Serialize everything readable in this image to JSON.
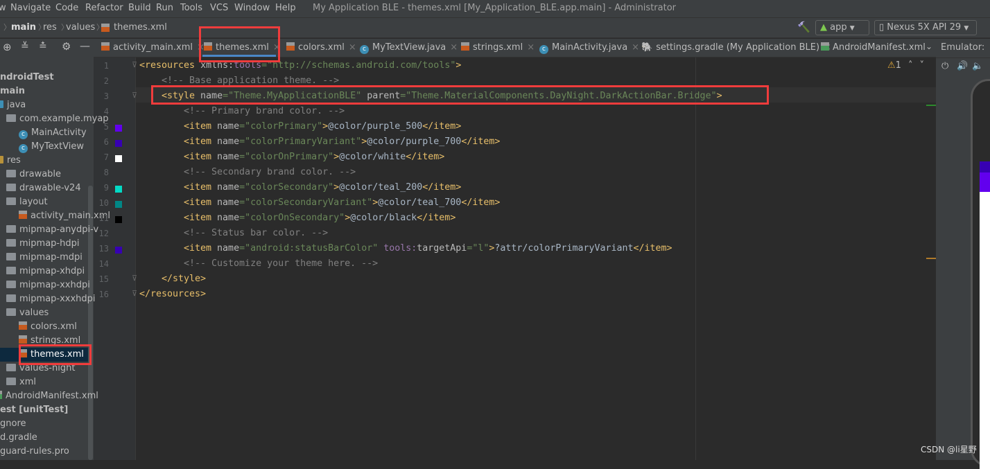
{
  "menu": [
    "w",
    "Navigate",
    "Code",
    "Refactor",
    "Build",
    "Run",
    "Tools",
    "VCS",
    "Window",
    "Help"
  ],
  "window_title": "My Application BLE - themes.xml [My_Application_BLE.app.main] - Administrator",
  "breadcrumb": [
    "main",
    "res",
    "values",
    "themes.xml"
  ],
  "toolbar": {
    "run_config": "app",
    "device": "Nexus 5X API 29"
  },
  "tabs": [
    {
      "label": "activity_main.xml",
      "icon": "xml"
    },
    {
      "label": "themes.xml",
      "icon": "xml",
      "active": true
    },
    {
      "label": "colors.xml",
      "icon": "xml"
    },
    {
      "label": "MyTextView.java",
      "icon": "class"
    },
    {
      "label": "strings.xml",
      "icon": "xml"
    },
    {
      "label": "MainActivity.java",
      "icon": "class"
    },
    {
      "label": "settings.gradle (My Application BLE)",
      "icon": "gradle"
    },
    {
      "label": "AndroidManifest.xml",
      "icon": "manifest"
    }
  ],
  "emulator_label": "Emulator:",
  "inspection": {
    "warnings": "1"
  },
  "tree": [
    {
      "label": "ndroidTest",
      "bold": true,
      "indent": 0,
      "icon": "none"
    },
    {
      "label": "main",
      "bold": true,
      "indent": 0,
      "icon": "none"
    },
    {
      "label": "java",
      "indent": 1,
      "icon": "folder-blue"
    },
    {
      "label": "com.example.myap",
      "indent": 2,
      "icon": "package"
    },
    {
      "label": "MainActivity",
      "indent": 3,
      "icon": "class"
    },
    {
      "label": "MyTextView",
      "indent": 3,
      "icon": "class"
    },
    {
      "label": "res",
      "indent": 1,
      "icon": "res"
    },
    {
      "label": "drawable",
      "indent": 2,
      "icon": "folder"
    },
    {
      "label": "drawable-v24",
      "indent": 2,
      "icon": "folder"
    },
    {
      "label": "layout",
      "indent": 2,
      "icon": "folder"
    },
    {
      "label": "activity_main.xml",
      "indent": 3,
      "icon": "xml"
    },
    {
      "label": "mipmap-anydpi-v",
      "indent": 2,
      "icon": "folder"
    },
    {
      "label": "mipmap-hdpi",
      "indent": 2,
      "icon": "folder"
    },
    {
      "label": "mipmap-mdpi",
      "indent": 2,
      "icon": "folder"
    },
    {
      "label": "mipmap-xhdpi",
      "indent": 2,
      "icon": "folder"
    },
    {
      "label": "mipmap-xxhdpi",
      "indent": 2,
      "icon": "folder"
    },
    {
      "label": "mipmap-xxxhdpi",
      "indent": 2,
      "icon": "folder"
    },
    {
      "label": "values",
      "indent": 2,
      "icon": "folder"
    },
    {
      "label": "colors.xml",
      "indent": 3,
      "icon": "xml"
    },
    {
      "label": "strings.xml",
      "indent": 3,
      "icon": "xml"
    },
    {
      "label": "themes.xml",
      "indent": 3,
      "icon": "xml",
      "selected": true
    },
    {
      "label": "values-night",
      "indent": 2,
      "icon": "folder"
    },
    {
      "label": "xml",
      "indent": 2,
      "icon": "folder"
    },
    {
      "label": "AndroidManifest.xml",
      "indent": 1,
      "icon": "manifest"
    },
    {
      "label": "est [unitTest]",
      "bold": true,
      "indent": 0,
      "icon": "none"
    },
    {
      "label": "gnore",
      "indent": 0,
      "icon": "none"
    },
    {
      "label": "d.gradle",
      "indent": 0,
      "icon": "none"
    },
    {
      "label": "guard-rules.pro",
      "indent": 0,
      "icon": "none"
    }
  ],
  "code": [
    {
      "n": "1",
      "indent": 0,
      "parts": [
        [
          "t",
          "<resources "
        ],
        [
          "a",
          "xmlns:"
        ],
        [
          "ns",
          "tools"
        ],
        [
          "v",
          "=\"http://schemas.android.com/tools\""
        ],
        [
          "t",
          ">"
        ]
      ]
    },
    {
      "n": "2",
      "indent": 1,
      "parts": [
        [
          "c",
          "<!-- Base application theme. -->"
        ]
      ]
    },
    {
      "n": "3",
      "indent": 1,
      "parts": [
        [
          "t",
          "<style "
        ],
        [
          "a",
          "name"
        ],
        [
          "v",
          "=\"Theme.MyApplicationBLE\" "
        ],
        [
          "a",
          "parent"
        ],
        [
          "v",
          "=\"Theme.MaterialComponents.DayNight.DarkActionBar.Bridge\""
        ],
        [
          "t",
          ">"
        ]
      ]
    },
    {
      "n": "4",
      "indent": 2,
      "parts": [
        [
          "c",
          "<!-- Primary brand color. -->"
        ]
      ]
    },
    {
      "n": "5",
      "indent": 2,
      "swatch": "#6200ee",
      "parts": [
        [
          "t",
          "<item "
        ],
        [
          "a",
          "name"
        ],
        [
          "v",
          "=\"colorPrimary\""
        ],
        [
          "t",
          ">"
        ],
        [
          "x",
          "@color/purple_500"
        ],
        [
          "t",
          "</item>"
        ]
      ]
    },
    {
      "n": "6",
      "indent": 2,
      "swatch": "#3700b3",
      "parts": [
        [
          "t",
          "<item "
        ],
        [
          "a",
          "name"
        ],
        [
          "v",
          "=\"colorPrimaryVariant\""
        ],
        [
          "t",
          ">"
        ],
        [
          "x",
          "@color/purple_700"
        ],
        [
          "t",
          "</item>"
        ]
      ]
    },
    {
      "n": "7",
      "indent": 2,
      "swatch": "#ffffff",
      "parts": [
        [
          "t",
          "<item "
        ],
        [
          "a",
          "name"
        ],
        [
          "v",
          "=\"colorOnPrimary\""
        ],
        [
          "t",
          ">"
        ],
        [
          "x",
          "@color/white"
        ],
        [
          "t",
          "</item>"
        ]
      ]
    },
    {
      "n": "8",
      "indent": 2,
      "parts": [
        [
          "c",
          "<!-- Secondary brand color. -->"
        ]
      ]
    },
    {
      "n": "9",
      "indent": 2,
      "swatch": "#03dac5",
      "parts": [
        [
          "t",
          "<item "
        ],
        [
          "a",
          "name"
        ],
        [
          "v",
          "=\"colorSecondary\""
        ],
        [
          "t",
          ">"
        ],
        [
          "x",
          "@color/teal_200"
        ],
        [
          "t",
          "</item>"
        ]
      ]
    },
    {
      "n": "10",
      "indent": 2,
      "swatch": "#018786",
      "parts": [
        [
          "t",
          "<item "
        ],
        [
          "a",
          "name"
        ],
        [
          "v",
          "=\"colorSecondaryVariant\""
        ],
        [
          "t",
          ">"
        ],
        [
          "x",
          "@color/teal_700"
        ],
        [
          "t",
          "</item>"
        ]
      ]
    },
    {
      "n": "11",
      "indent": 2,
      "swatch": "#000000",
      "parts": [
        [
          "t",
          "<item "
        ],
        [
          "a",
          "name"
        ],
        [
          "v",
          "=\"colorOnSecondary\""
        ],
        [
          "t",
          ">"
        ],
        [
          "x",
          "@color/black"
        ],
        [
          "t",
          "</item>"
        ]
      ]
    },
    {
      "n": "12",
      "indent": 2,
      "parts": [
        [
          "c",
          "<!-- Status bar color. -->"
        ]
      ]
    },
    {
      "n": "13",
      "indent": 2,
      "swatch": "#3700b3",
      "parts": [
        [
          "t",
          "<item "
        ],
        [
          "a",
          "name"
        ],
        [
          "v",
          "=\"android:statusBarColor\" "
        ],
        [
          "ns",
          "tools:"
        ],
        [
          "a",
          "targetApi"
        ],
        [
          "v",
          "=\"l\""
        ],
        [
          "t",
          ">"
        ],
        [
          "x",
          "?attr/colorPrimaryVariant"
        ],
        [
          "t",
          "</item>"
        ]
      ]
    },
    {
      "n": "14",
      "indent": 2,
      "parts": [
        [
          "c",
          "<!-- Customize your theme here. -->"
        ]
      ]
    },
    {
      "n": "15",
      "indent": 1,
      "parts": [
        [
          "t",
          "</style>"
        ]
      ]
    },
    {
      "n": "16",
      "indent": 0,
      "parts": [
        [
          "t",
          "</resources>"
        ]
      ]
    }
  ],
  "watermark": "CSDN @li星野",
  "colors": {
    "highlight": "#f03c3c",
    "accent": "#4a88c7"
  }
}
